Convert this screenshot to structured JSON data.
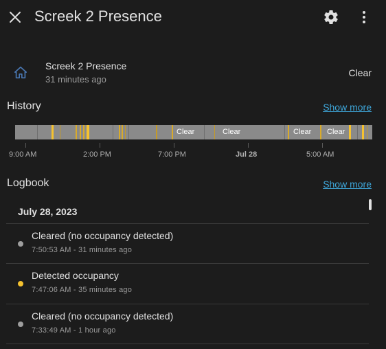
{
  "header": {
    "title": "Screek 2 Presence"
  },
  "entity": {
    "name": "Screek 2 Presence",
    "last_changed": "31 minutes ago",
    "state": "Clear",
    "icon": "home-icon",
    "icon_color": "#4a78b4"
  },
  "history": {
    "title": "History",
    "show_more": "Show more",
    "segment_labels": [
      "Clear",
      "Clear",
      "Clear",
      "Clear"
    ],
    "axis_labels": [
      "9:00 AM",
      "2:00 PM",
      "7:00 PM",
      "Jul 28",
      "5:00 AM"
    ],
    "colors": {
      "clear": "#8a8a8a",
      "detected": "#f5c22f"
    }
  },
  "logbook": {
    "title": "Logbook",
    "show_more": "Show more",
    "date": "July 28, 2023",
    "entries": [
      {
        "message": "Cleared (no occupancy detected)",
        "time": "7:50:53 AM - 31 minutes ago",
        "state": "clear"
      },
      {
        "message": "Detected occupancy",
        "time": "7:47:06 AM - 35 minutes ago",
        "state": "detected"
      },
      {
        "message": "Cleared (no occupancy detected)",
        "time": "7:33:49 AM - 1 hour ago",
        "state": "clear"
      }
    ]
  },
  "colors": {
    "background": "#1c1c1c",
    "link": "#3ea6d9",
    "dot_clear": "#9e9e9e",
    "dot_detected": "#f5c22f"
  }
}
